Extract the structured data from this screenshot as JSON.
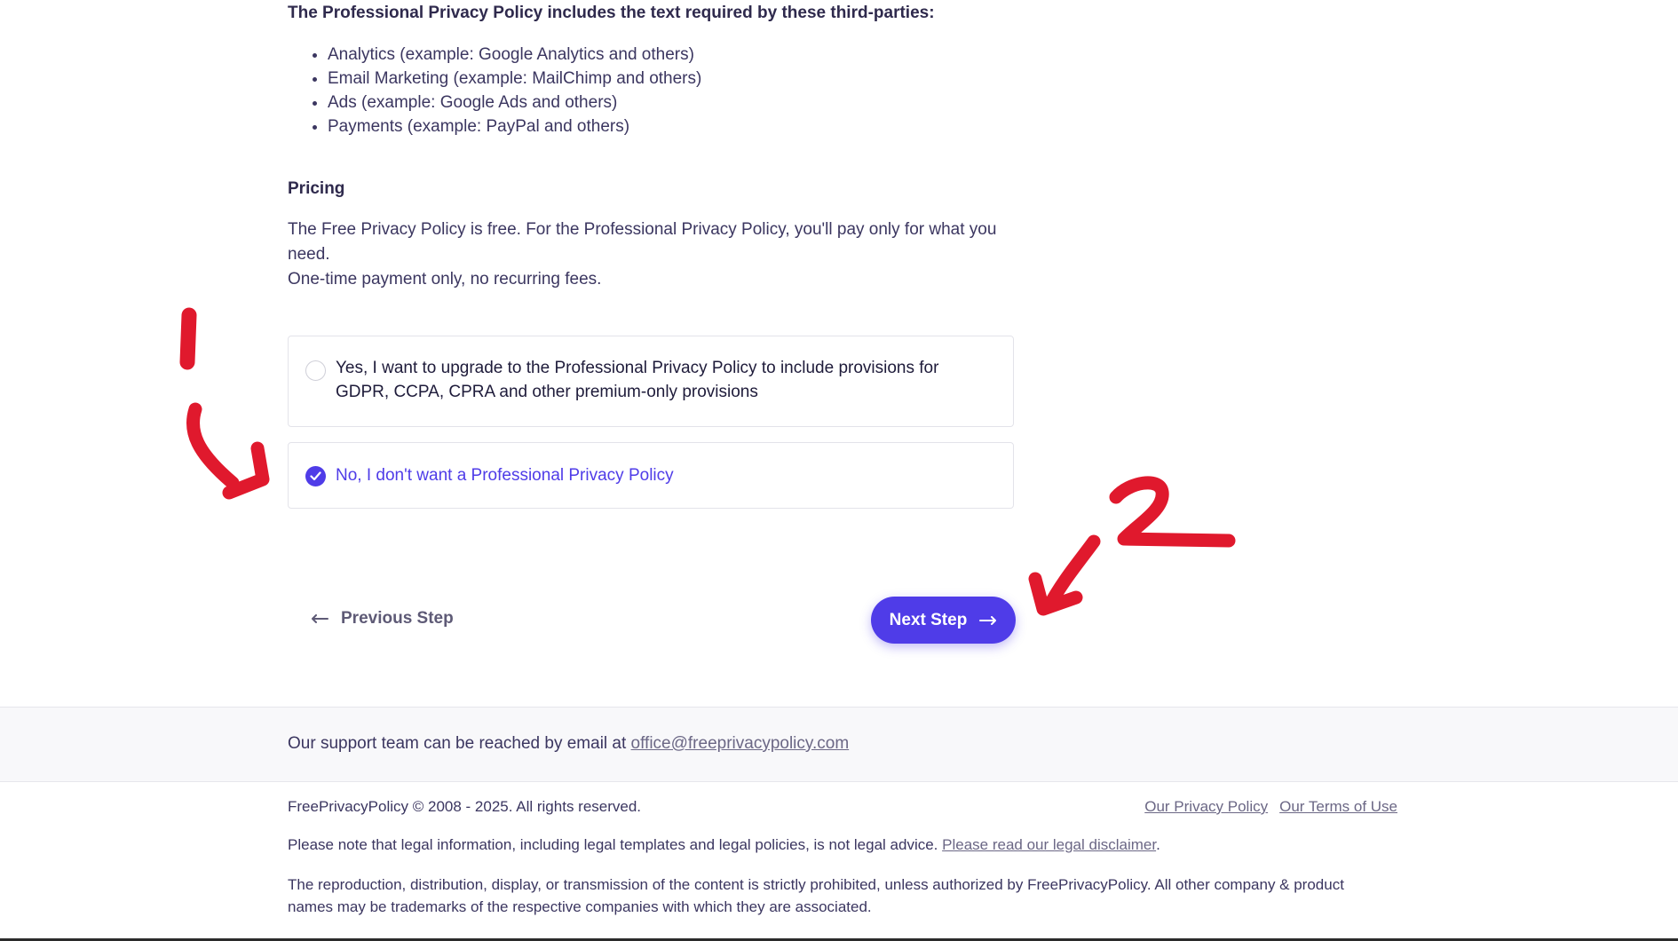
{
  "intro": {
    "heading": "The Professional Privacy Policy includes the text required by these third-parties:",
    "items": [
      "Analytics (example: Google Analytics and others)",
      "Email Marketing (example: MailChimp and others)",
      "Ads (example: Google Ads and others)",
      "Payments (example: PayPal and others)"
    ]
  },
  "pricing": {
    "heading": "Pricing",
    "line1": "The Free Privacy Policy is free. For the Professional Privacy Policy, you'll pay only for what you need.",
    "line2": "One-time payment only, no recurring fees."
  },
  "options": {
    "yes_label": "Yes, I want to upgrade to the Professional Privacy Policy to include provisions for GDPR, CCPA, CPRA and other premium-only provisions",
    "no_label": "No, I don't want a Professional Privacy Policy",
    "selected": "no"
  },
  "navigation": {
    "previous_label": "Previous Step",
    "next_label": "Next Step"
  },
  "support": {
    "text": "Our support team can be reached by email at ",
    "email": "office@freeprivacypolicy.com"
  },
  "footer": {
    "copyright": "FreePrivacyPolicy © 2008 - 2025. All rights reserved.",
    "privacy_link": "Our Privacy Policy",
    "terms_link": "Our Terms of Use",
    "note_text": "Please note that legal information, including legal templates and legal policies, is not legal advice. ",
    "disclaimer_link": "Please read our legal disclaimer",
    "note_end": ".",
    "reproduction": "The reproduction, distribution, display, or transmission of the content is strictly prohibited, unless authorized by FreePrivacyPolicy. All other company & product names may be trademarks of the respective companies with which they are associated."
  },
  "colors": {
    "accent": "#4f3ce8",
    "annotation": "#e0192d"
  }
}
